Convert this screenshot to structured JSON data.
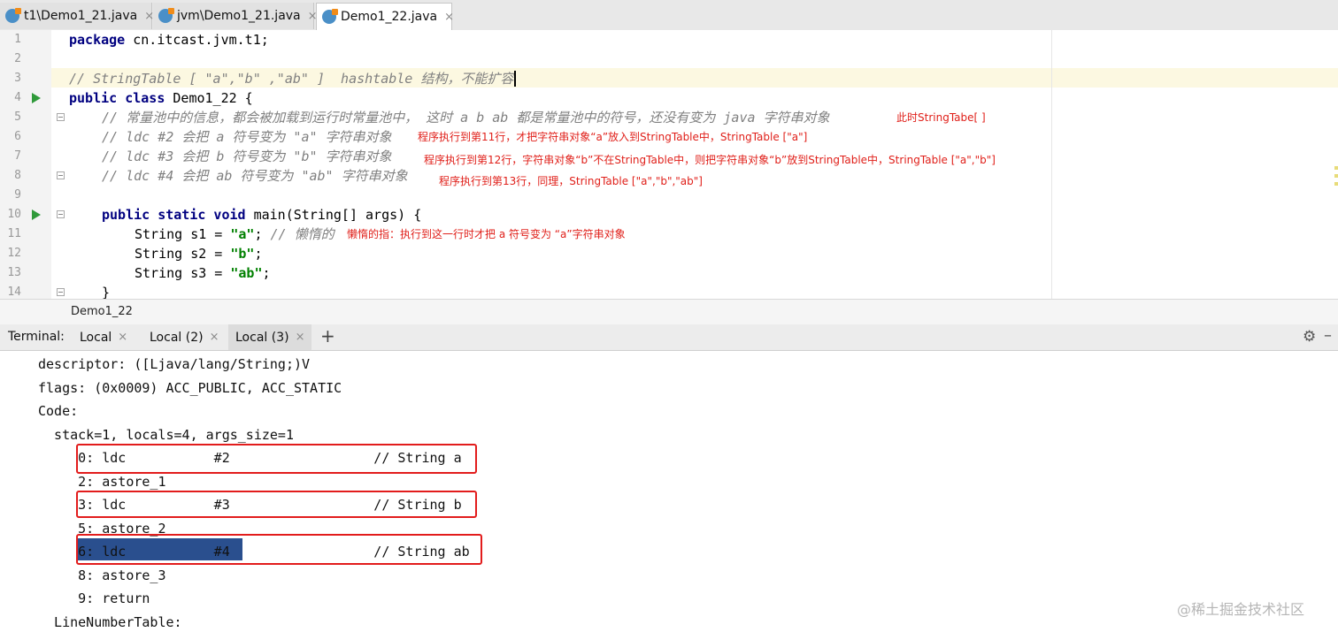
{
  "tabs": [
    {
      "label": "t1\\Demo1_21.java"
    },
    {
      "label": "jvm\\Demo1_21.java"
    },
    {
      "label": "Demo1_22.java"
    }
  ],
  "close_glyph": "×",
  "editor": {
    "line_numbers": [
      "1",
      "2",
      "3",
      "4",
      "5",
      "6",
      "7",
      "8",
      "9",
      "10",
      "11",
      "12",
      "13",
      "14"
    ],
    "line1": {
      "kw": "package",
      "rest": " cn.itcast.jvm.t1;"
    },
    "line3": {
      "comment": "// StringTable [ \"a\",\"b\" ,\"ab\" ]  hashtable 结构，不能扩容"
    },
    "line4": {
      "kw": "public class",
      "rest": " Demo1_22 {"
    },
    "line5": {
      "comment": "// 常量池中的信息，都会被加载到运行时常量池中， 这时 a b ab 都是常量池中的符号，还没有变为 java 字符串对象"
    },
    "line6": {
      "comment": "// ldc #2 会把 a 符号变为 \"a\" 字符串对象"
    },
    "line7": {
      "comment": "// ldc #3 会把 b 符号变为 \"b\" 字符串对象"
    },
    "line8": {
      "comment": "// ldc #4 会把 ab 符号变为 \"ab\" 字符串对象"
    },
    "line10": {
      "kw": "public static void",
      "rest": " main(String[] args) {"
    },
    "line11": {
      "pre": "String s1 = ",
      "str": "\"a\"",
      "post": "; ",
      "comment": "// 懒惰的"
    },
    "line12": {
      "pre": "String s2 = ",
      "str": "\"b\"",
      "post": ";"
    },
    "line13": {
      "pre": "String s3 = ",
      "str": "\"ab\"",
      "post": ";"
    },
    "line14": {
      "rest": "}"
    }
  },
  "annotations": {
    "a5": "此时StringTabe[ ]",
    "a6": "程序执行到第11行，才把字符串对象“a”放入到StringTable中，StringTable [\"a\"]",
    "a7": "程序执行到第12行，字符串对象“b”不在StringTable中，则把字符串对象“b”放到StringTable中，StringTable [\"a\",\"b\"]",
    "a8": "程序执行到第13行，同理，StringTable [\"a\",\"b\",\"ab\"]",
    "a11": "懒惰的指：执行到这一行时才把 a 符号变为 “a”字符串对象"
  },
  "breadcrumb": "Demo1_22",
  "terminal": {
    "label": "Terminal:",
    "tabs": [
      "Local",
      "Local (2)",
      "Local (3)"
    ],
    "active_tab": "Local (3)",
    "plus": "+",
    "gear": "⚙",
    "minus": "–",
    "lines": [
      "descriptor: ([Ljava/lang/String;)V",
      "flags: (0x0009) ACC_PUBLIC, ACC_STATIC",
      "Code:",
      "  stack=1, locals=4, args_size=1",
      "     0: ldc           #2                  // String a",
      "     2: astore_1",
      "     3: ldc           #3                  // String b",
      "     5: astore_2",
      "     6: ldc           #4                  // String ab",
      "     8: astore_3",
      "     9: return",
      "  LineNumberTable:"
    ]
  },
  "watermark": "@稀土掘金技术社区"
}
